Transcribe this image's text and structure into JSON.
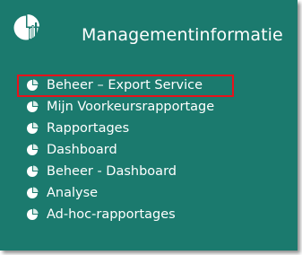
{
  "header": {
    "title": "Managementinformatie",
    "icon": "pie-chart-icon"
  },
  "menu": {
    "items": [
      {
        "label": "Beheer – Export Service",
        "icon": "pie-chart-icon",
        "highlighted": true
      },
      {
        "label": "Mijn Voorkeursrapportage",
        "icon": "pie-chart-icon"
      },
      {
        "label": "Rapportages",
        "icon": "pie-chart-icon"
      },
      {
        "label": "Dashboard",
        "icon": "pie-chart-icon"
      },
      {
        "label": "Beheer - Dashboard",
        "icon": "pie-chart-icon"
      },
      {
        "label": "Analyse",
        "icon": "pie-chart-icon"
      },
      {
        "label": "Ad-hoc-rapportages",
        "icon": "pie-chart-icon"
      }
    ]
  },
  "colors": {
    "panel_background": "#1b7a6e",
    "text": "#ffffff",
    "highlight_border": "#e8121b"
  }
}
